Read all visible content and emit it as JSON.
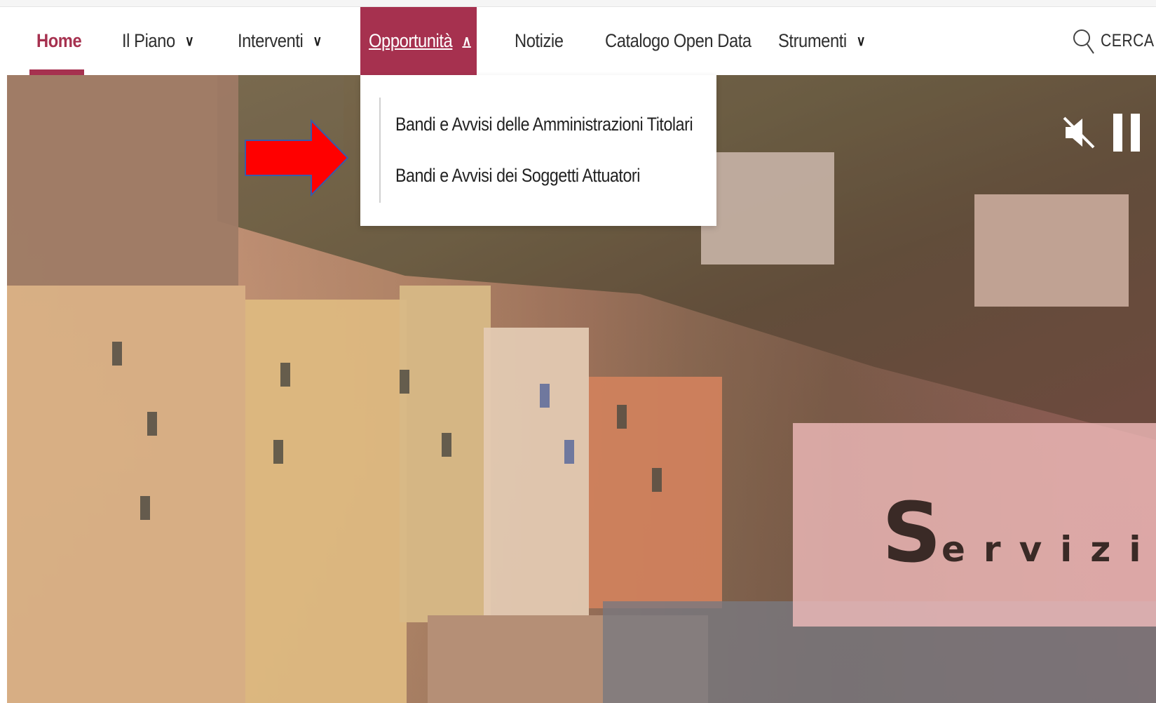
{
  "nav": {
    "home": "Home",
    "piano": "Il Piano",
    "interventi": "Interventi",
    "opportunita": "Opportunità",
    "notizie": "Notizie",
    "catalogo": "Catalogo Open Data",
    "strumenti": "Strumenti",
    "search_label": "CERCA"
  },
  "dropdown": {
    "items": [
      "Bandi e Avvisi delle Amministrazioni Titolari",
      "Bandi e Avvisi dei Soggetti Attuatori"
    ]
  },
  "hero": {
    "banner_initial": "S",
    "banner_rest": "ervizi:"
  },
  "icons": {
    "chevron_down": "chevron-down-icon",
    "chevron_up": "chevron-up-icon",
    "search": "search-icon",
    "mute": "volume-mute-icon",
    "pause": "pause-icon",
    "arrow": "red-arrow-annotation"
  },
  "colors": {
    "accent": "#a6314f",
    "annotation_arrow": "#ff0000",
    "banner_bg": "#f3bebe"
  }
}
